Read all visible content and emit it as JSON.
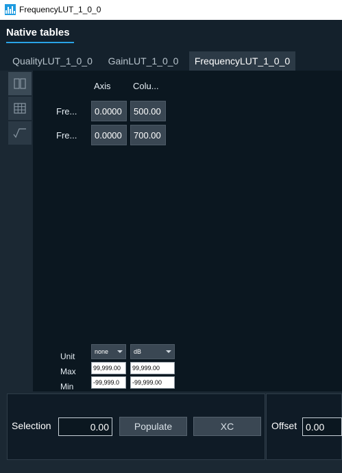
{
  "window": {
    "title": "FrequencyLUT_1_0_0",
    "icon": "waveform-app-icon"
  },
  "header": {
    "title": "Native tables"
  },
  "tabs": [
    {
      "label": "QualityLUT_1_0_0",
      "active": false
    },
    {
      "label": "GainLUT_1_0_0",
      "active": false
    },
    {
      "label": "FrequencyLUT_1_0_0",
      "active": true
    }
  ],
  "sidebar": {
    "items": [
      {
        "icon": "columns-view-icon",
        "active": true
      },
      {
        "icon": "grid-view-icon",
        "active": false
      },
      {
        "icon": "formula-view-icon",
        "active": false
      }
    ]
  },
  "table": {
    "columns": [
      "Axis",
      "Colu..."
    ],
    "rows": [
      {
        "label": "Fre...",
        "axis": "0.0000",
        "value": "500.00"
      },
      {
        "label": "Fre...",
        "axis": "0.0000",
        "value": "700.00"
      }
    ]
  },
  "properties": {
    "unit_label": "Unit",
    "max_label": "Max",
    "min_label": "Min",
    "axis_unit": "none",
    "value_unit": "dB",
    "axis_max": "99,999.00",
    "value_max": "99,999.00",
    "axis_min": "-99,999.0",
    "value_min": "-99,999.00"
  },
  "bottom": {
    "selection_label": "Selection",
    "selection_value": "0.00",
    "populate_label": "Populate",
    "xc_label": "XC",
    "offset_label": "Offset",
    "offset_value": "0.00"
  },
  "colors": {
    "accent": "#2aa3e6",
    "background": "#0b1720",
    "panel": "#1b2833",
    "cell": "#3a4753"
  }
}
